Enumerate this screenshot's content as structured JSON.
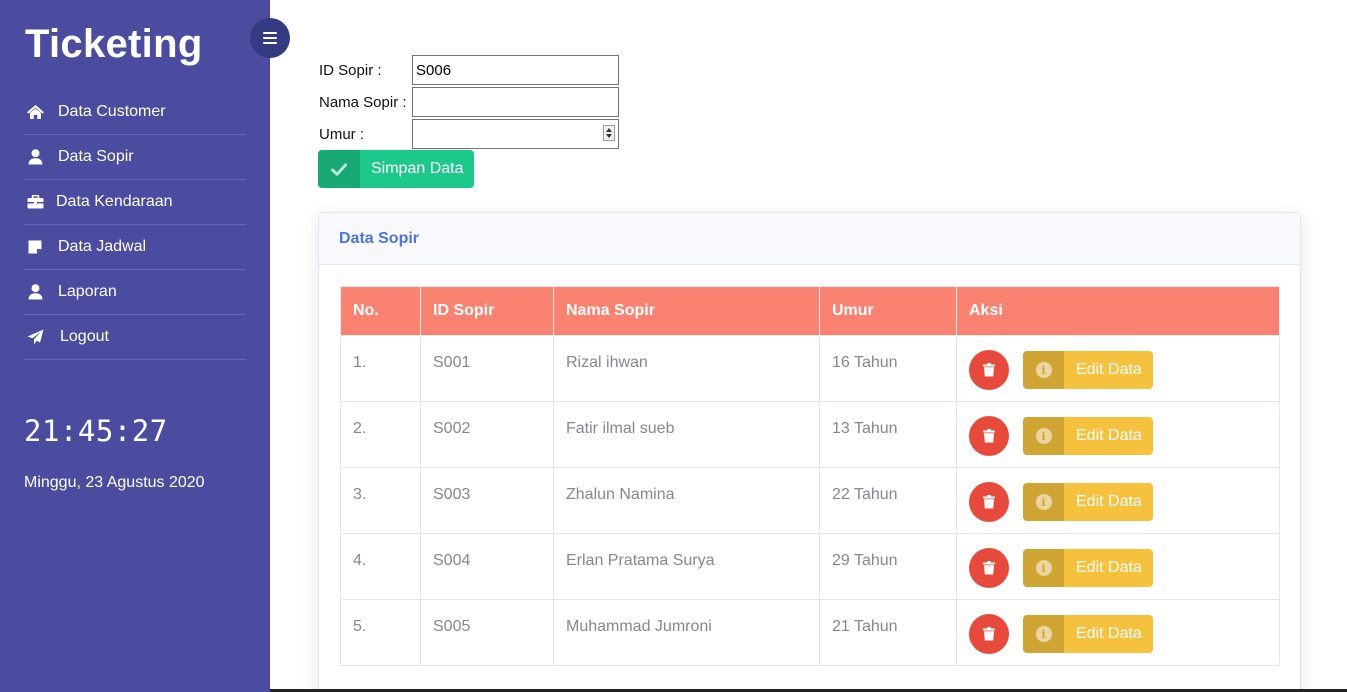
{
  "app": {
    "title": "Ticketing"
  },
  "sidebar": {
    "items": [
      {
        "label": "Data Customer",
        "icon": "home-icon"
      },
      {
        "label": "Data Sopir",
        "icon": "user-icon"
      },
      {
        "label": "Data Kendaraan",
        "icon": "briefcase-icon"
      },
      {
        "label": "Data Jadwal",
        "icon": "sticky-note-icon"
      },
      {
        "label": "Laporan",
        "icon": "user-icon"
      },
      {
        "label": "Logout",
        "icon": "paper-plane-icon"
      }
    ],
    "clock": "21:45:27",
    "date": "Minggu, 23 Agustus 2020"
  },
  "form": {
    "id_label": "ID Sopir :",
    "id_value": "S006",
    "nama_label": "Nama Sopir :",
    "nama_value": "",
    "umur_label": "Umur :",
    "umur_value": "",
    "save_label": "Simpan Data"
  },
  "card": {
    "title": "Data Sopir",
    "columns": [
      "No.",
      "ID Sopir",
      "Nama Sopir",
      "Umur",
      "Aksi"
    ],
    "rows": [
      {
        "no": "1.",
        "id": "S001",
        "nama": "Rizal ihwan",
        "umur": "16 Tahun"
      },
      {
        "no": "2.",
        "id": "S002",
        "nama": "Fatir ilmal sueb",
        "umur": "13 Tahun"
      },
      {
        "no": "3.",
        "id": "S003",
        "nama": "Zhalun Namina",
        "umur": "22 Tahun"
      },
      {
        "no": "4.",
        "id": "S004",
        "nama": "Erlan Pratama Surya",
        "umur": "29 Tahun"
      },
      {
        "no": "5.",
        "id": "S005",
        "nama": "Muhammad Jumroni",
        "umur": "21 Tahun"
      }
    ],
    "edit_label": "Edit Data"
  },
  "colors": {
    "sidebar": "#4b4ba0",
    "header": "#f98370",
    "save": "#1cc88a",
    "delete": "#e74a3b",
    "edit": "#f6c23e",
    "card_title": "#4e73df"
  }
}
